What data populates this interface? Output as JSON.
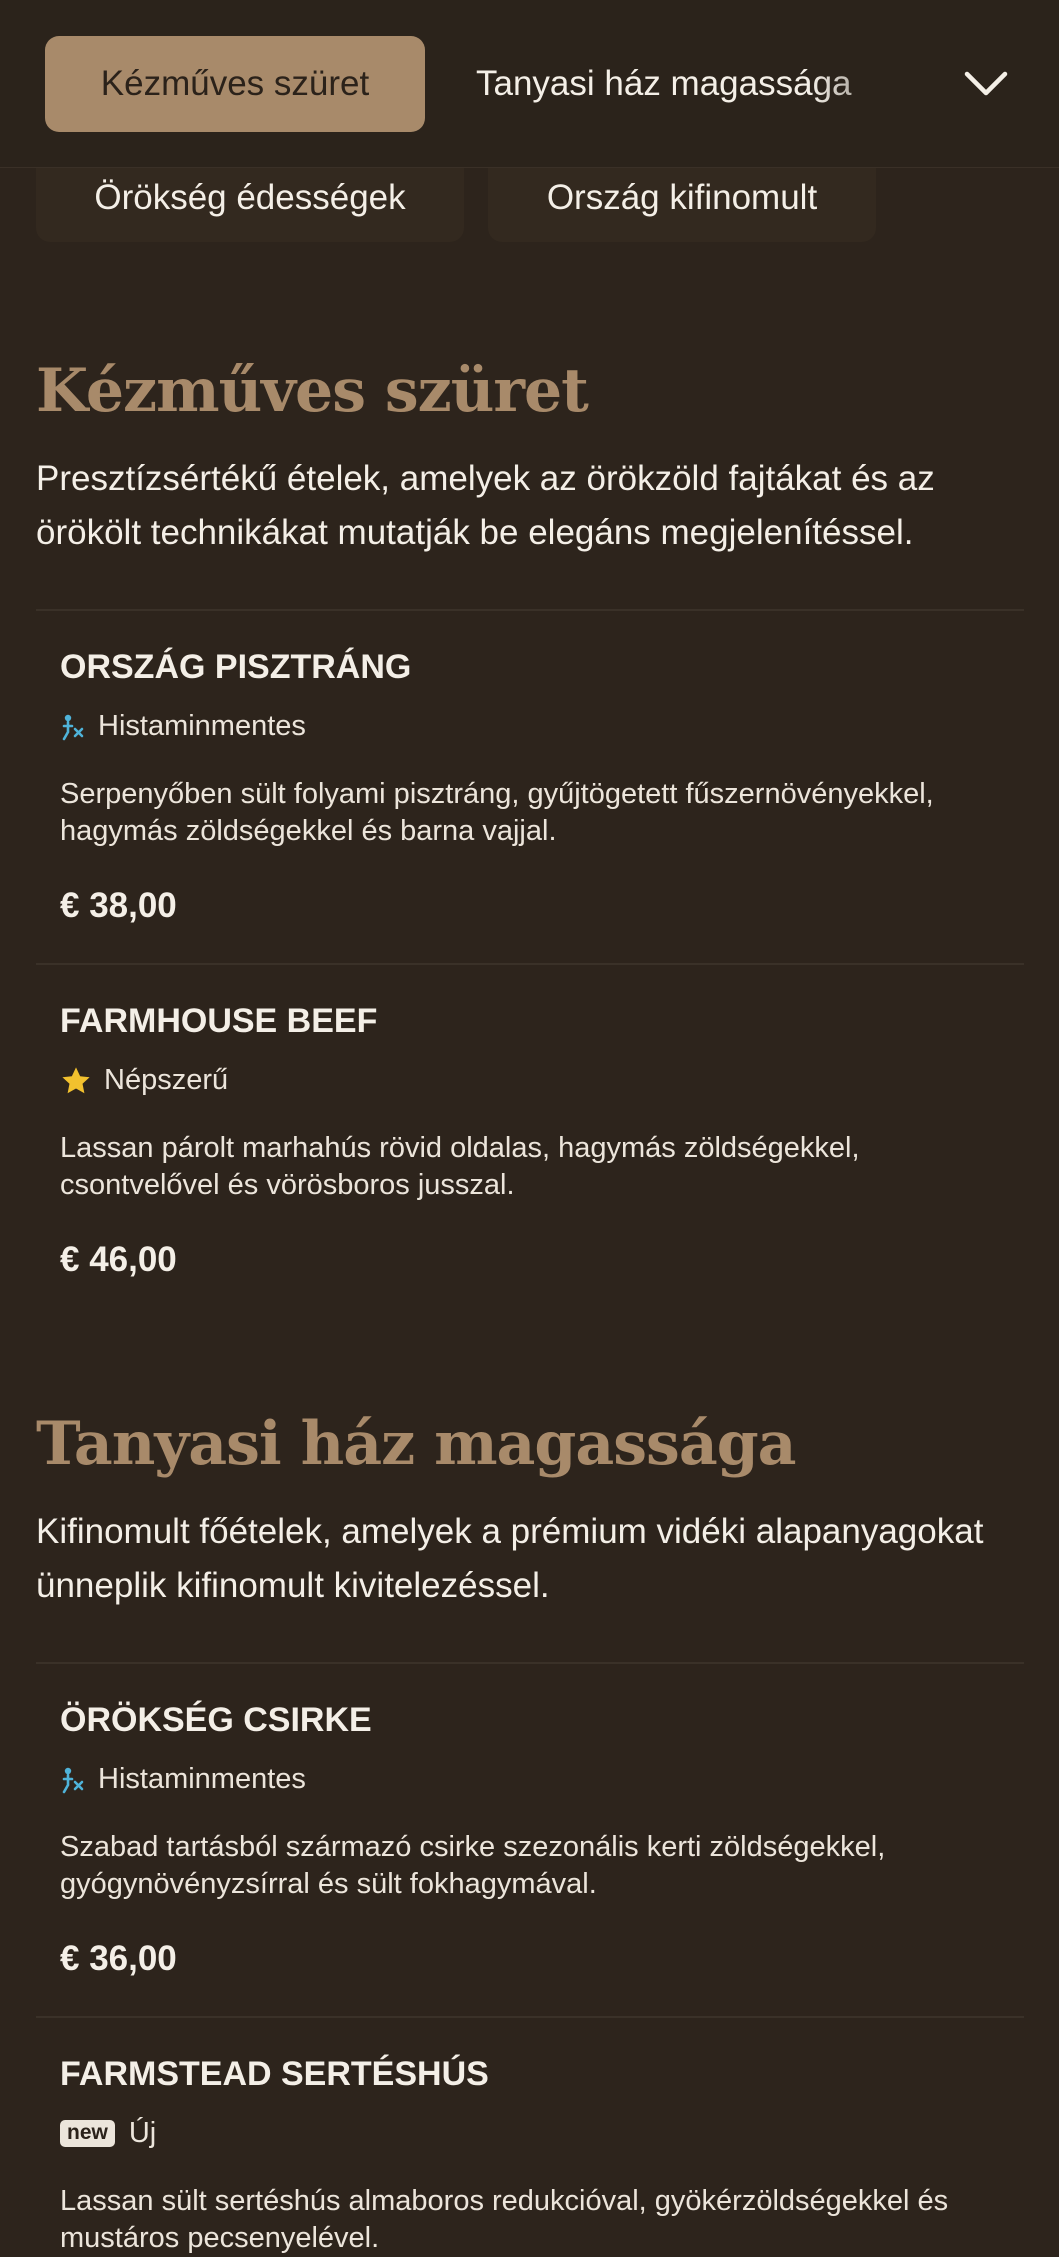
{
  "nav": {
    "active_category": "Kézműves szüret",
    "next_category": "Tanyasi ház magassága",
    "tabs": [
      {
        "label": "Örökség édességek"
      },
      {
        "label": "Ország kifinomult"
      }
    ]
  },
  "sections": [
    {
      "title": "Kézműves szüret",
      "description": "Presztízsértékű ételek, amelyek az örökzöld fajtákat és az örökölt technikákat mutatják be elegáns megjelenítéssel.",
      "items": [
        {
          "name": "ORSZÁG PISZTRÁNG",
          "badge_icon": "histamine-free-icon",
          "badge": "Histaminmentes",
          "description": "Serpenyőben sült folyami pisztráng, gyűjtögetett fűszernövényekkel, hagymás zöldségekkel és barna vajjal.",
          "price": "€ 38,00"
        },
        {
          "name": "FARMHOUSE BEEF",
          "badge_icon": "star-icon",
          "badge": "Népszerű",
          "description": "Lassan párolt marhahús rövid oldalas, hagymás zöldségekkel, csontvelővel és vörösboros jusszal.",
          "price": "€ 46,00"
        }
      ]
    },
    {
      "title": "Tanyasi ház magassága",
      "description": "Kifinomult főételek, amelyek a prémium vidéki alapanyagokat ünneplik kifinomult kivitelezéssel.",
      "items": [
        {
          "name": "ÖRÖKSÉG CSIRKE",
          "badge_icon": "histamine-free-icon",
          "badge": "Histaminmentes",
          "description": "Szabad tartásból származó csirke szezonális kerti zöldségekkel, gyógynövényzsírral és sült fokhagymával.",
          "price": "€ 36,00"
        },
        {
          "name": "FARMSTEAD SERTÉSHÚS",
          "badge_tag": "new",
          "badge": "Új",
          "description": "Lassan sült sertéshús almaboros redukcióval, gyökérzöldségekkel és mustáros pecsenyelével."
        }
      ]
    }
  ],
  "colors": {
    "background": "#2d241c",
    "accent": "#a88a6a",
    "text": "#f4efe7",
    "histamine_icon": "#4fb3d9",
    "star": "#f2c12e"
  }
}
